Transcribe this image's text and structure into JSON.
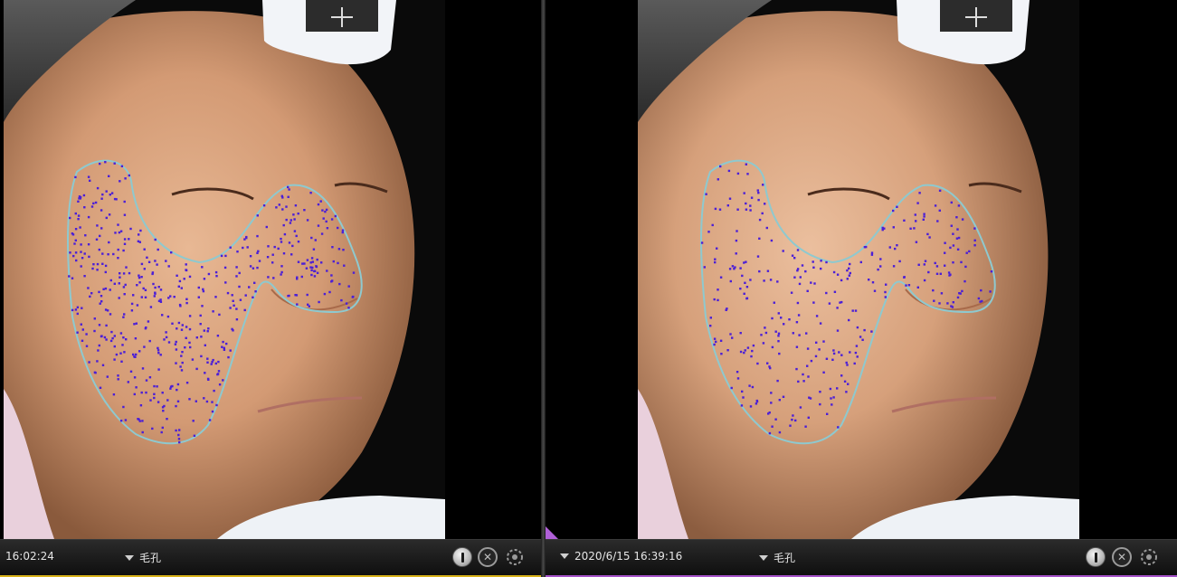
{
  "colors": {
    "left_accent": "#d8b21a",
    "right_accent": "#a552c8",
    "pore_marker": "#4b1fd6",
    "roi_outline": "#8ec9cf"
  },
  "left_panel": {
    "timestamp": "16:02:24",
    "analysis_mode": "毛孔",
    "buttons": [
      "info-icon",
      "close-icon",
      "settings-icon"
    ]
  },
  "right_panel": {
    "timestamp": "2020/6/15 16:39:16",
    "analysis_mode": "毛孔",
    "buttons": [
      "info-icon",
      "close-icon",
      "settings-icon"
    ]
  }
}
